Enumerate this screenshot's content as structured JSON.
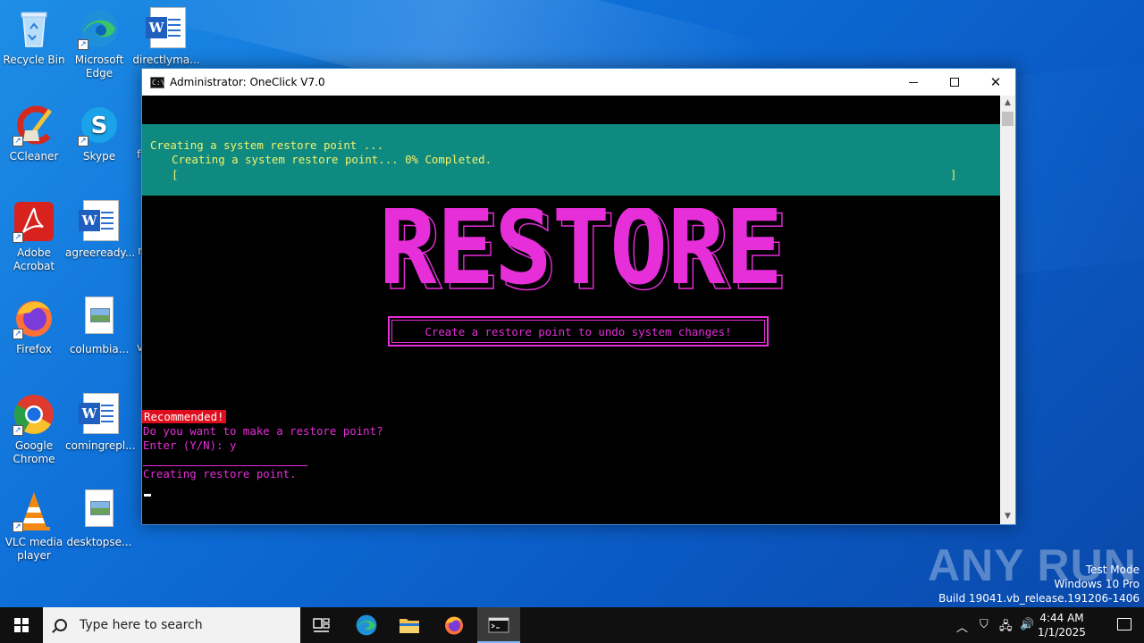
{
  "desktop": {
    "icons": [
      {
        "label": "Recycle Bin"
      },
      {
        "label": "Microsoft Edge"
      },
      {
        "label": "directlyma..."
      },
      {
        "label": "CCleaner"
      },
      {
        "label": "Skype"
      },
      {
        "label": "Adobe Acrobat"
      },
      {
        "label": "agreeready..."
      },
      {
        "label": "Firefox"
      },
      {
        "label": "columbia..."
      },
      {
        "label": "Google Chrome"
      },
      {
        "label": "comingrepl..."
      },
      {
        "label": "VLC media player"
      },
      {
        "label": "desktopse..."
      }
    ],
    "clipped_labels": [
      "f",
      "r",
      "v"
    ]
  },
  "window": {
    "title": "Administrator:  OneClick V7.0",
    "icon_glyph": "C:\\",
    "progress": {
      "line1": "Creating a system restore point ...",
      "line2": "Creating a system restore point... 0% Completed.",
      "bar_open": "[",
      "bar_close": "]",
      "percent": 0
    },
    "banner_text": "RESTORE",
    "tagline": "Create a restore point to undo system changes!",
    "recommended": "Recommended!",
    "question": "Do you want to make a restore point?",
    "prompt": "Enter (Y/N): y",
    "status": "Creating restore point.",
    "close_glyph": "✕"
  },
  "watermark": {
    "brand": "ANY RUN",
    "mode": "Test Mode",
    "edition": "Windows 10 Pro",
    "build": "Build 19041.vb_release.191206-1406"
  },
  "taskbar": {
    "search_placeholder": "Type here to search",
    "time": "4:44 AM",
    "date": "1/1/2025"
  },
  "colors": {
    "accent_magenta": "#e62ed9",
    "panel_teal": "#0f8a80",
    "progress_text": "#f4f26a",
    "recommended_bg": "#e00d1e"
  }
}
